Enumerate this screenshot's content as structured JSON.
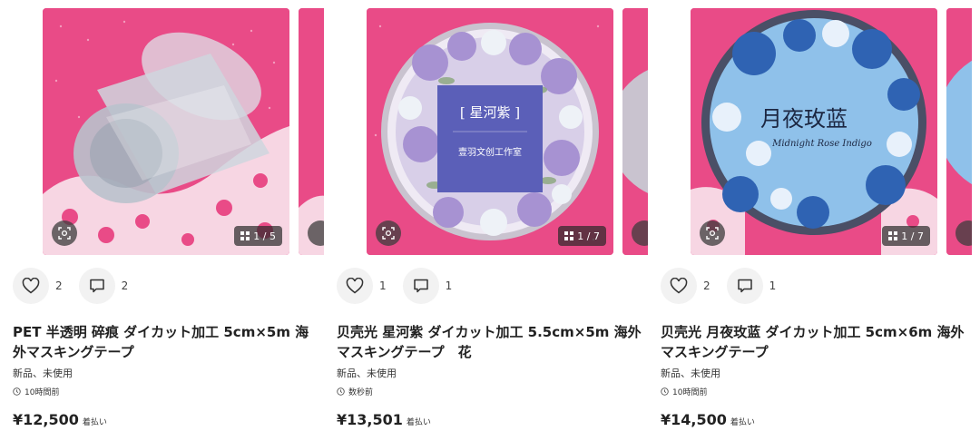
{
  "items": [
    {
      "likes": "2",
      "comments": "2",
      "title": "PET 半透明 碎痕 ダイカット加工 5cm×5m 海外マスキングテープ",
      "condition": "新品、未使用",
      "time": "10時間前",
      "price": "¥12,500",
      "shipping": "着払い",
      "image_count": "1 / 5"
    },
    {
      "likes": "1",
      "comments": "1",
      "title": "贝壳光 星河紫 ダイカット加工 5.5cm×5m 海外マスキングテープ　花",
      "condition": "新品、未使用",
      "time": "数秒前",
      "price": "¥13,501",
      "shipping": "着払い",
      "image_count": "1 / 7",
      "tape_label": "[ 星河紫 ]",
      "tape_sub": "壹羽文创工作室"
    },
    {
      "likes": "2",
      "comments": "1",
      "title": "贝壳光 月夜玫蓝 ダイカット加工 5cm×6m 海外マスキングテープ",
      "condition": "新品、未使用",
      "time": "10時間前",
      "price": "¥14,500",
      "shipping": "着払い",
      "image_count": "1 / 7",
      "tape_label": "月夜玫蓝",
      "tape_sub": "Midnight Rose Indigo"
    }
  ],
  "colors": {
    "pink_background": "#e94b87",
    "violet_tape": "#5b5fb8",
    "blue_tape": "#8fc1ea"
  },
  "icons": [
    "heart-icon",
    "comment-icon",
    "lens-search-icon",
    "grid-icon",
    "clock-icon"
  ]
}
